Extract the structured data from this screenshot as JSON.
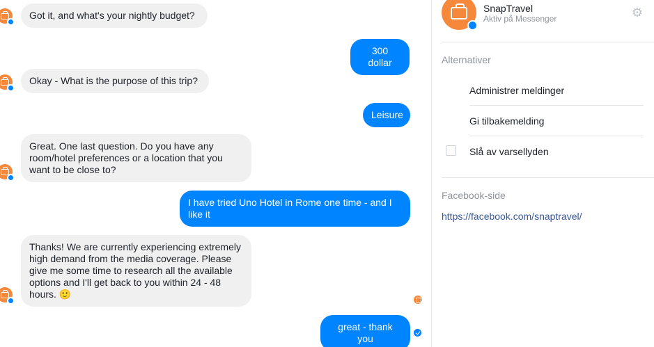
{
  "conversation": {
    "messages": [
      {
        "side": "in",
        "text": "Got it, and what's your nightly budget?"
      },
      {
        "side": "out",
        "text": "300 dollar"
      },
      {
        "side": "in",
        "text": "Okay - What is the purpose of this trip?"
      },
      {
        "side": "out",
        "text": "Leisure"
      },
      {
        "side": "in",
        "text": "Great. One last question. Do you have any room/hotel preferences or a location that you want to be close to?"
      },
      {
        "side": "out",
        "text": "I have tried Uno Hotel in Rome one time - and I like it"
      },
      {
        "side": "in",
        "text": "Thanks! We are currently experiencing extremely high demand from the media coverage. Please give me some time to research all the available options and I'll get back to you within 24 - 48 hours. 🙂"
      },
      {
        "side": "out",
        "text": "great - thank you"
      }
    ]
  },
  "panel": {
    "contact_name": "SnapTravel",
    "contact_status": "Aktiv på Messenger",
    "options_title": "Alternativer",
    "options": [
      "Administrer meldinger",
      "Gi tilbakemelding",
      "Slå av varsellyden"
    ],
    "facebook_title": "Facebook-side",
    "facebook_url": "https://facebook.com/snaptravel/"
  },
  "colors": {
    "accent": "#0084ff",
    "brand": "#f5883b",
    "incoming_bubble": "#f1f0f0",
    "link": "#365899"
  },
  "icons": [
    "suitcase-icon",
    "messenger-badge-icon",
    "gear-icon",
    "seen-avatar-icon",
    "sent-check-icon"
  ]
}
